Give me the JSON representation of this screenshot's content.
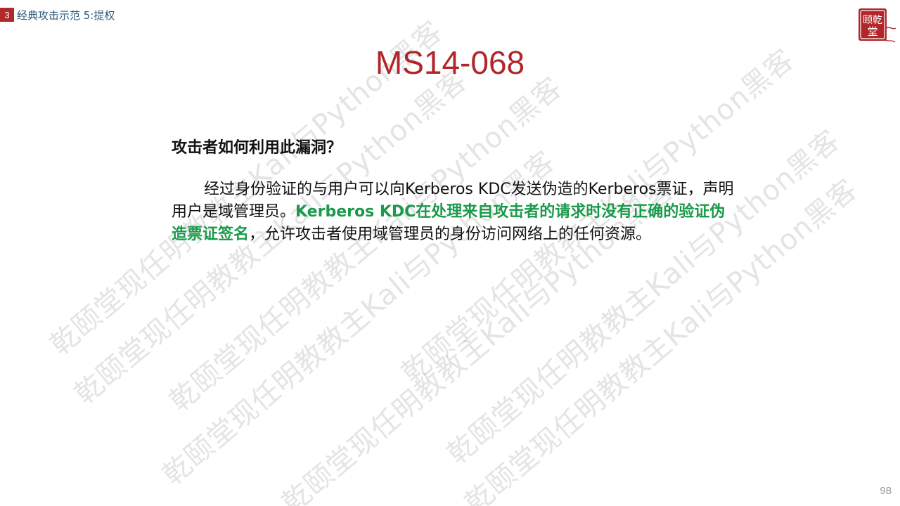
{
  "header": {
    "section_number": "3",
    "section_title": "经典攻击示范 5:提权",
    "accent_color": "#b02a2a",
    "title_color": "#2f5b7c"
  },
  "logo": {
    "text_top": "颐乾",
    "text_bottom": "堂",
    "color": "#b0262a"
  },
  "slide": {
    "title": "MS14-068",
    "title_color": "#b0262a",
    "question": "攻击者如何利用此漏洞？",
    "paragraph_part1": "经过身份验证的与用户可以向Kerberos KDC发送伪造的Kerberos票证，声明用户是域管理员。",
    "paragraph_highlight": "Kerberos KDC在处理来自攻击者的请求时没有正确的验证伪造票证签名",
    "paragraph_part2": "，允许攻击者使用域管理员的身份访问网络上的任何资源。",
    "highlight_color": "#1a9a4a",
    "page_number": "98"
  },
  "watermark": {
    "text": "乾颐堂现任明教教主Kali与Python黑客",
    "color": "#aaaaaa"
  }
}
